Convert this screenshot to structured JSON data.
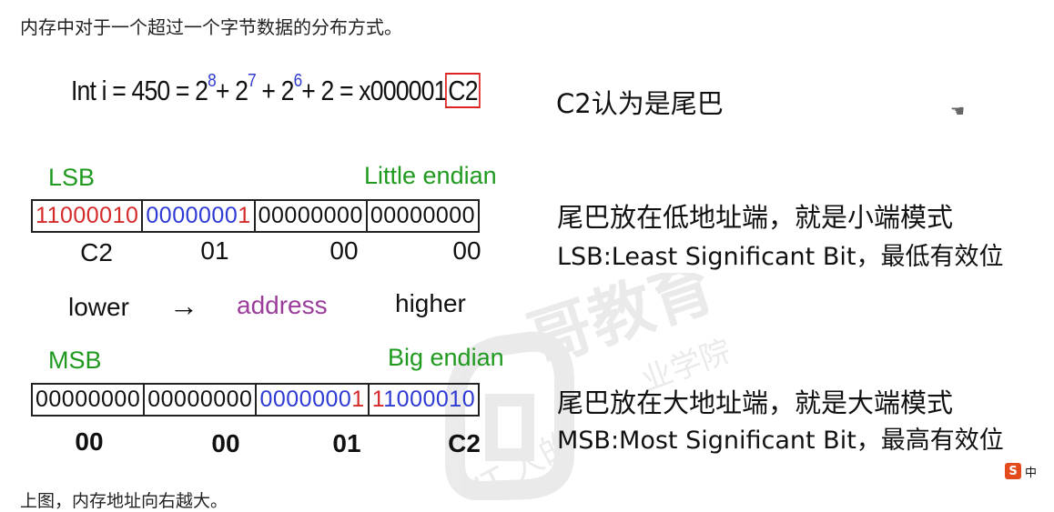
{
  "captions": {
    "top": "内存中对于一个超过一个字节数据的分布方式。",
    "bottom": "上图，内存地址向右越大。"
  },
  "formula": {
    "p1": "Int i = 450 = 2",
    "e1": "8",
    "p2": "+  2",
    "e2": "7",
    "p3": " + 2",
    "e3": "6",
    "p4": "+ 2 = x000001",
    "boxed": "C2"
  },
  "notes": {
    "c2_tail": "C2认为是尾巴",
    "little_desc": "尾巴放在低地址端，就是小端模式",
    "lsb_desc": "LSB:Least Significant Bit，最低有效位",
    "big_desc": "尾巴放在大地址端，就是大端模式",
    "msb_desc": "MSB:Most Significant Bit，最高有效位"
  },
  "little": {
    "sig_label": "LSB",
    "endian_label": "Little endian",
    "bytes": [
      {
        "red": "1",
        "black": "1000010",
        "blue": "",
        "redtail": ""
      },
      {
        "red": "",
        "black": "",
        "blue": "0000000",
        "redtail": "1"
      },
      {
        "black": "00000000"
      },
      {
        "black": "00000000"
      }
    ],
    "hex": [
      "C2",
      "01",
      "00",
      "00"
    ]
  },
  "direction": {
    "lower": "lower",
    "arrow": "→",
    "address": "address",
    "higher": "higher"
  },
  "big": {
    "sig_label": "MSB",
    "endian_label": "Big endian",
    "bytes": [
      {
        "black": "00000000"
      },
      {
        "black": "00000000"
      },
      {
        "blue": "0000000",
        "redtail": "1"
      },
      {
        "red": "1",
        "blue": "1000010"
      }
    ],
    "hex": [
      "00",
      "00",
      "01",
      "C2"
    ]
  },
  "watermark": {
    "brand": "哥教育",
    "sub": "业学院",
    "bottom": "IT 人的"
  },
  "icons": {
    "hand": "hand-cursor-icon",
    "ime": "sogou-ime-icon",
    "ime_text": "中"
  },
  "colors": {
    "green": "#1f9a1f",
    "red": "#d52a2a",
    "blue": "#2d3ad4",
    "purple": "#9b3d9b"
  }
}
